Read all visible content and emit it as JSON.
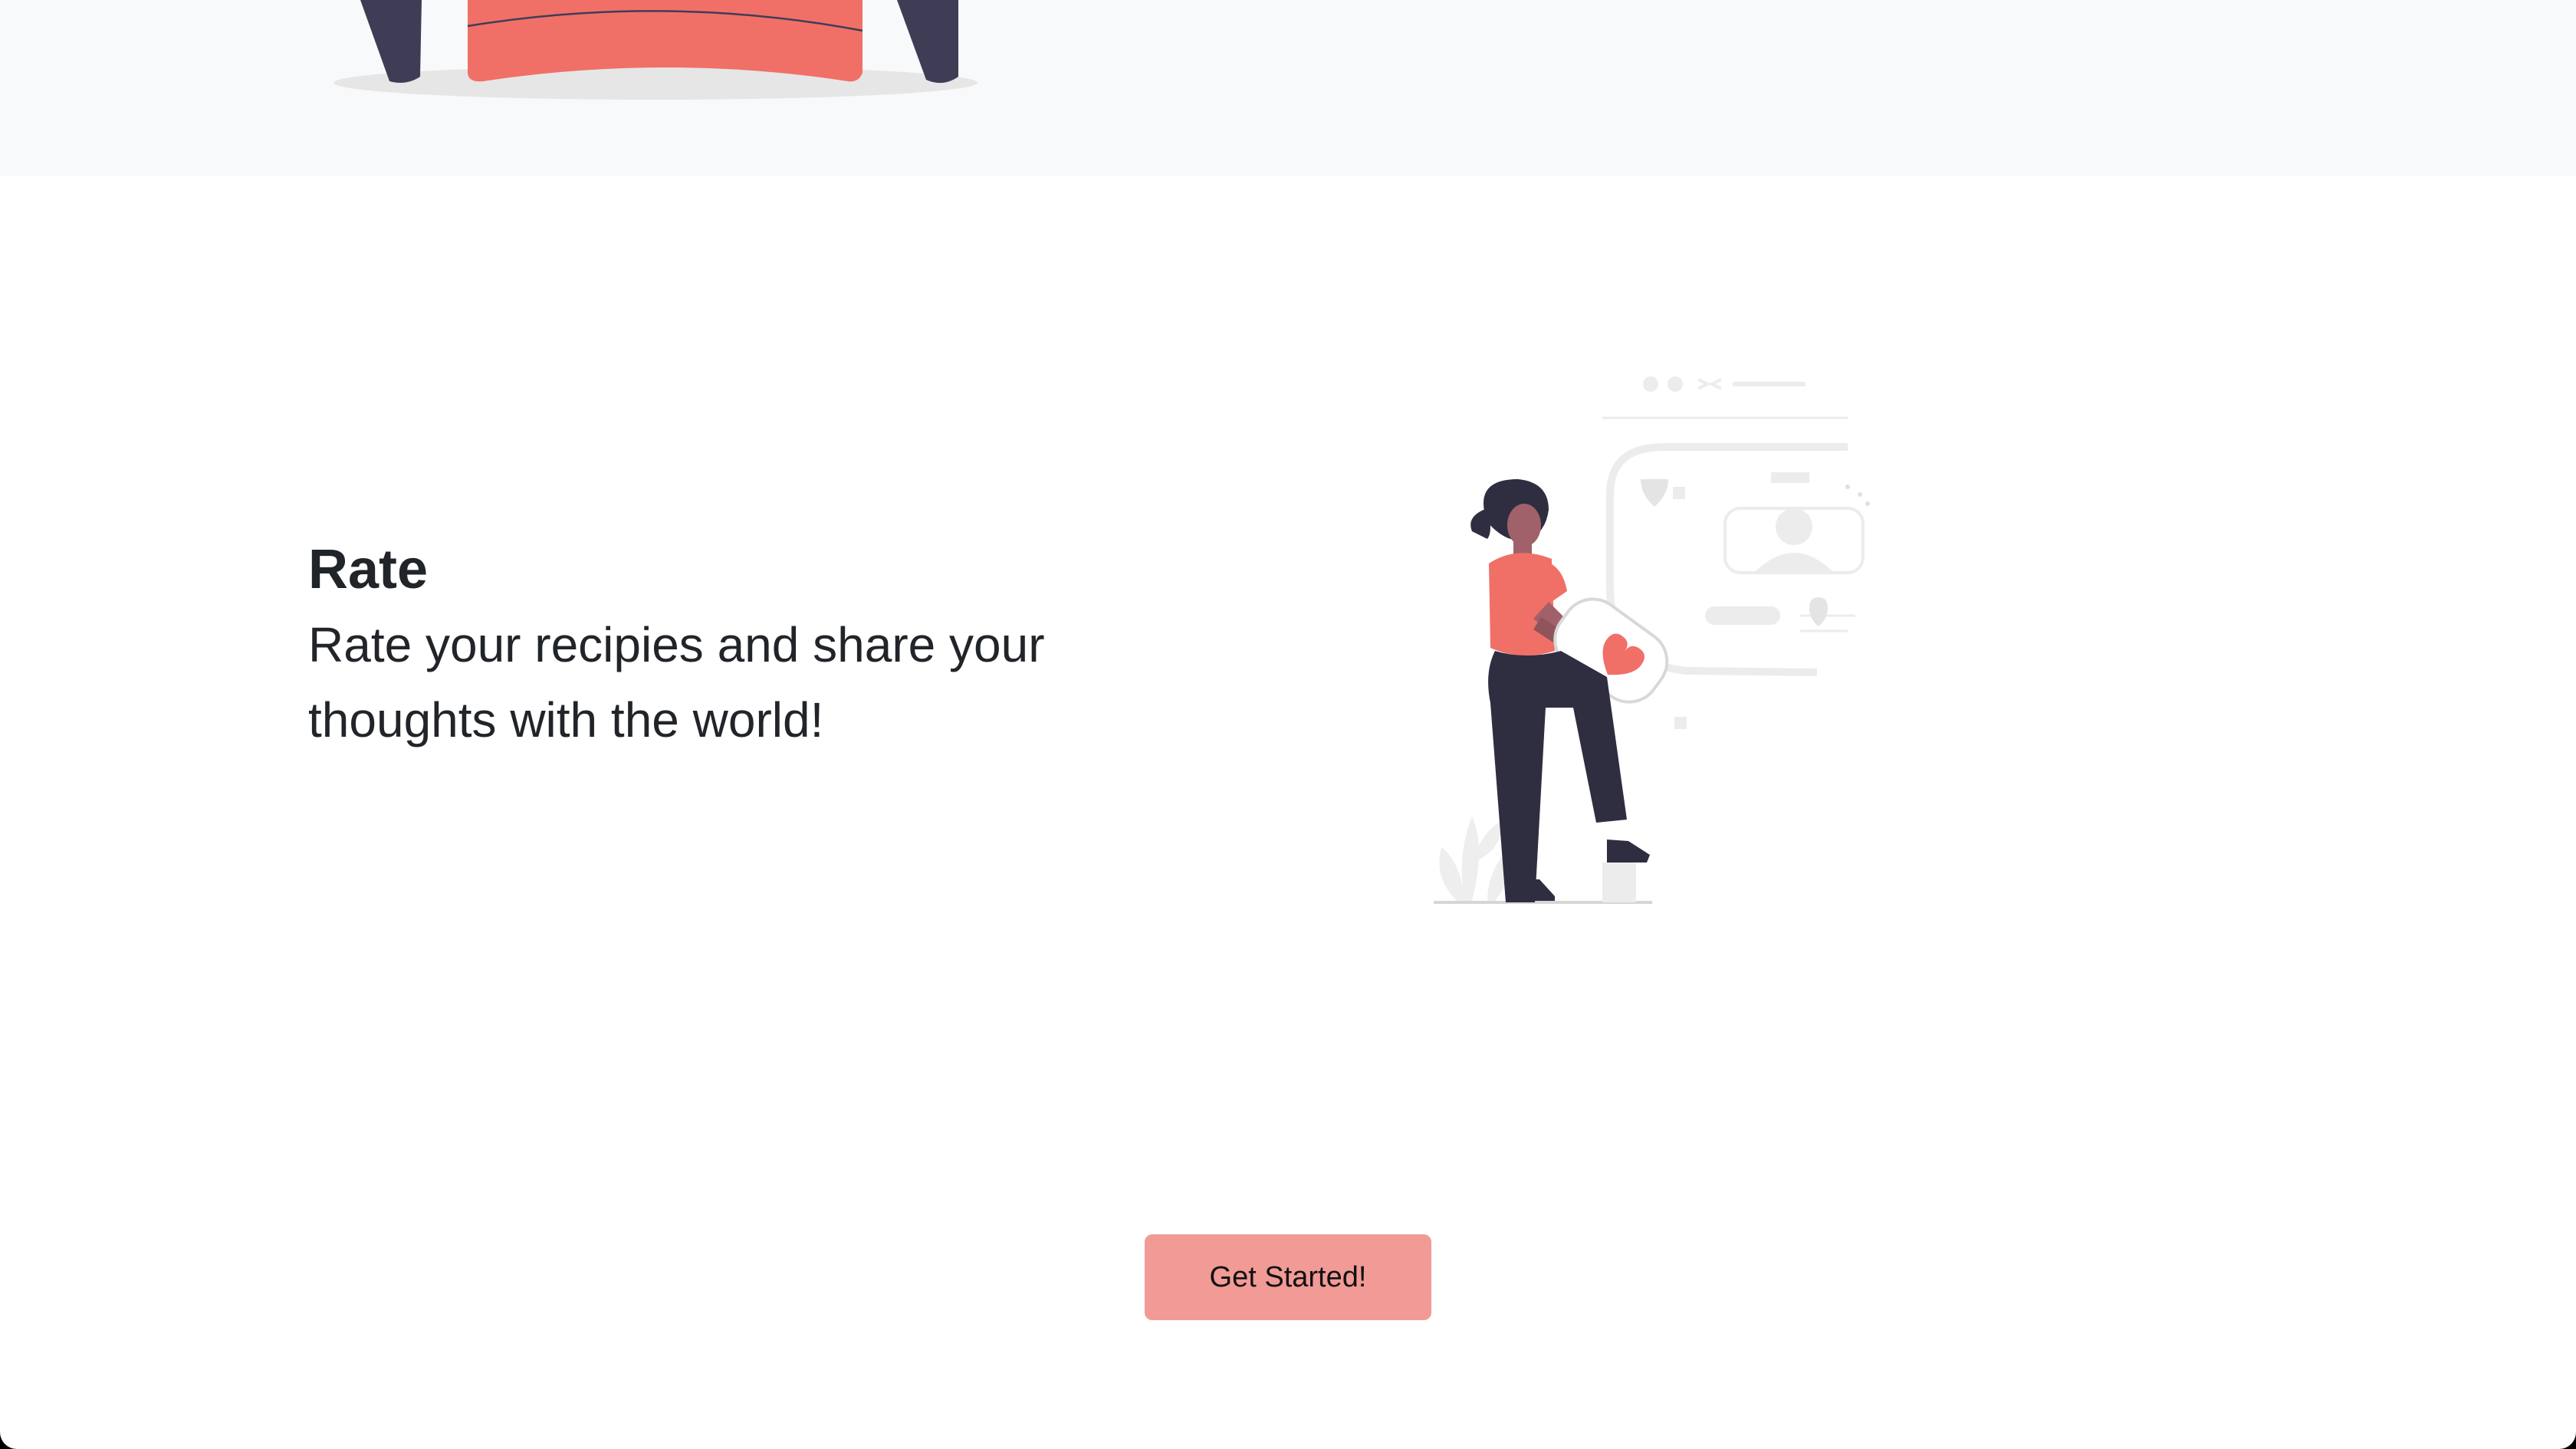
{
  "feature": {
    "title": "Rate",
    "description": "Rate your recipies and share your thoughts with the world!"
  },
  "cta": {
    "label": "Get Started!"
  },
  "colors": {
    "accent": "#f07067",
    "button": "#f19a96",
    "dark": "#3f3d56",
    "band": "#f8f9fa",
    "text": "#212529"
  },
  "icons": {
    "top": "chair-illustration",
    "feature": "woman-holding-heart-illustration"
  }
}
